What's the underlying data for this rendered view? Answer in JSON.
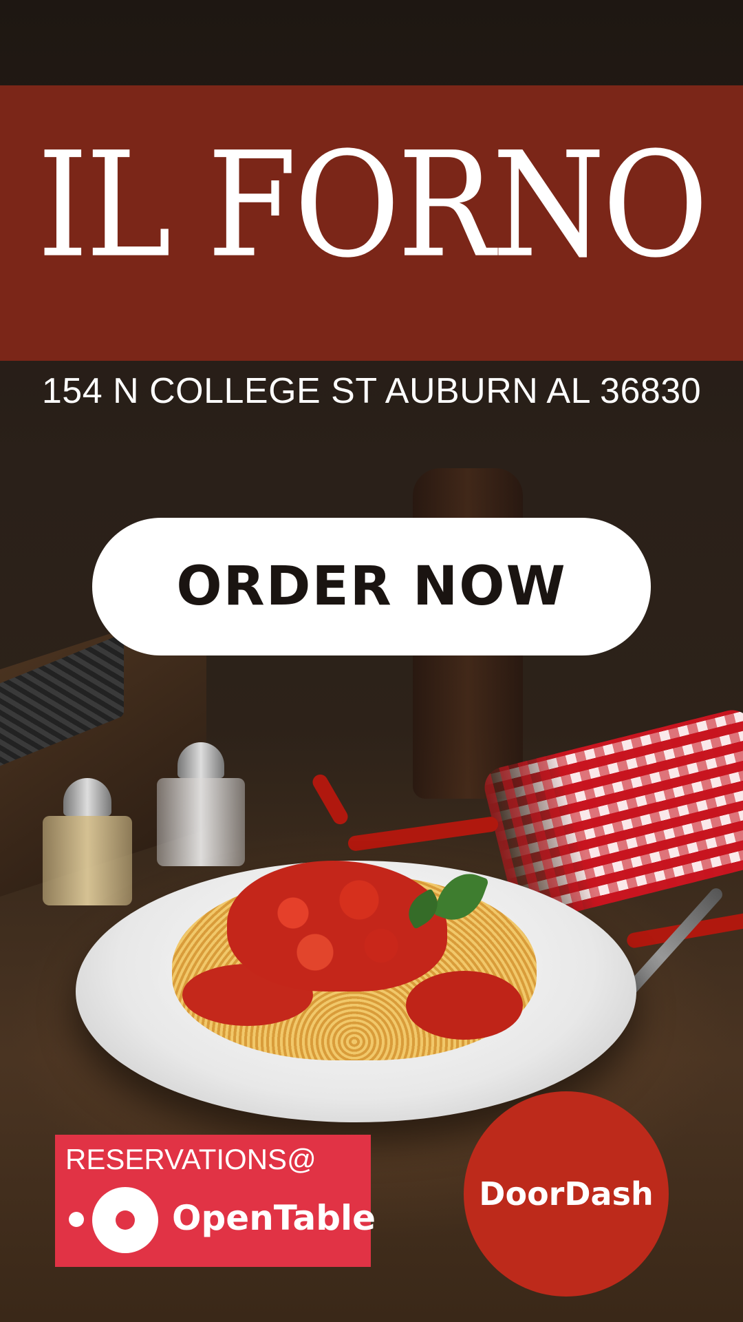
{
  "header": {
    "title": "IL FORNO",
    "address": "154 N COLLEGE ST AUBURN AL 36830"
  },
  "main": {
    "order_button_label": "ORDER NOW",
    "hero_image": "spaghetti-with-tomato-sauce"
  },
  "reservations": {
    "label": "RESERVATIONS@",
    "brand": "OpenTable",
    "icon": "opentable-logo-icon"
  },
  "delivery": {
    "brand": "DoorDash"
  },
  "colors": {
    "title_band": "#7b2618",
    "opentable_red": "#e13345",
    "doordash_red": "#bd2a1b",
    "button_bg": "#ffffff",
    "button_text": "#1a1411"
  }
}
